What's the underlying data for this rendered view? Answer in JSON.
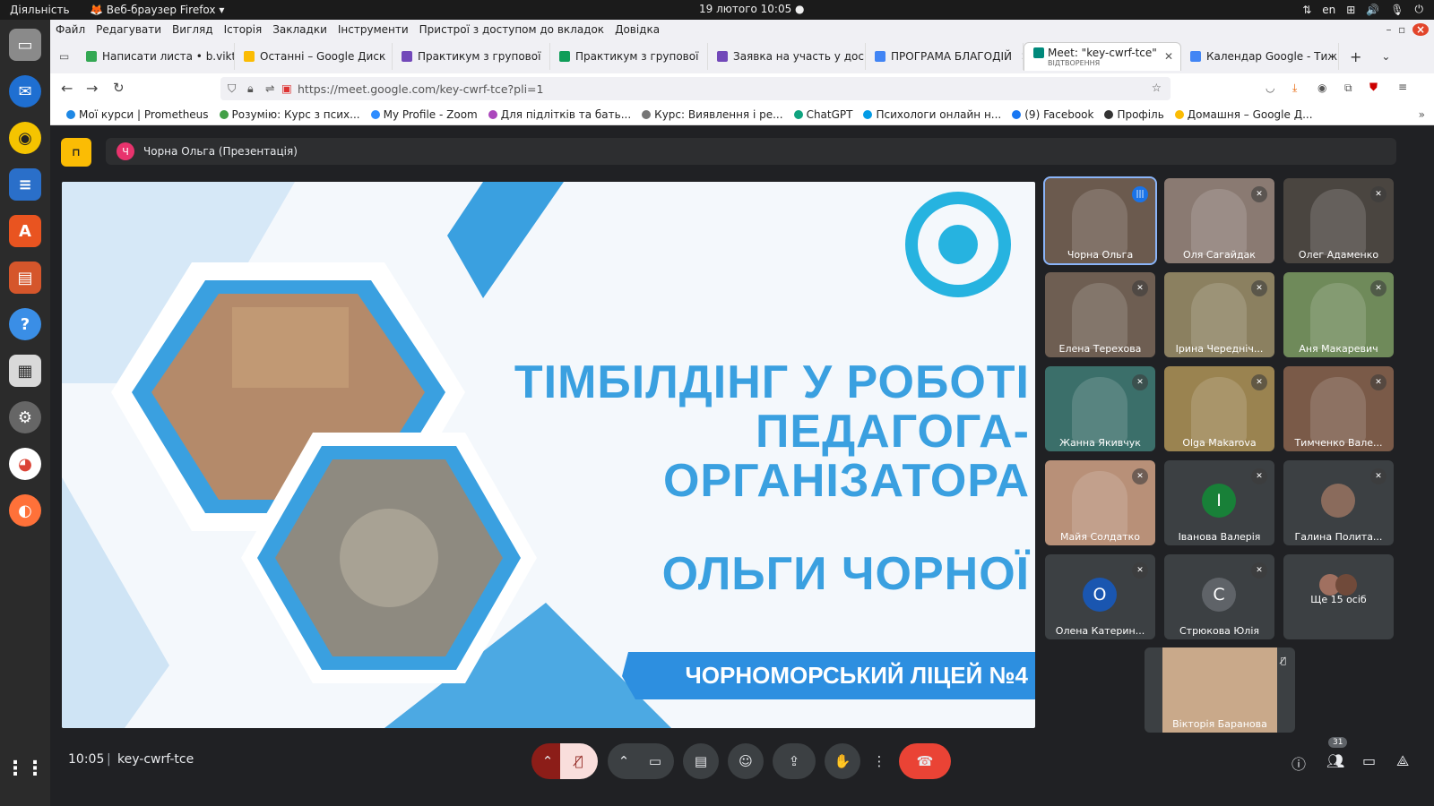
{
  "system": {
    "activities": "Діяльність",
    "app_menu": "Веб-браузер Firefox",
    "clock": "19 лютого  10:05",
    "lang": "en"
  },
  "menu": [
    "Файл",
    "Редагувати",
    "Вигляд",
    "Історія",
    "Закладки",
    "Інструменти",
    "Пристрої з доступом до вкладок",
    "Довідка"
  ],
  "tabs": [
    {
      "label": "Написати листа • b.vikt",
      "color": "#34a853"
    },
    {
      "label": "Останні – Google Диск",
      "color": "#fbbc04"
    },
    {
      "label": "Практикум з групової",
      "color": "#7248b9"
    },
    {
      "label": "Практикум з групової",
      "color": "#0f9d58"
    },
    {
      "label": "Заявка на участь у дос",
      "color": "#7248b9"
    },
    {
      "label": "ПРОГРАМА БЛАГОДІЙ",
      "color": "#4285f4"
    },
    {
      "label": "Meet: \"key-cwrf-tce\"",
      "sublabel": "ВІДТВОРЕННЯ",
      "color": "#00897b",
      "active": true
    },
    {
      "label": "Календар Google - Тиж",
      "color": "#4285f4"
    }
  ],
  "url": "https://meet.google.com/key-cwrf-tce?pli=1",
  "bookmarks": [
    {
      "label": "Мої курси | Prometheus",
      "color": "#1e88e5"
    },
    {
      "label": "Розумію: Курс з псих...",
      "color": "#43a047"
    },
    {
      "label": "My Profile - Zoom",
      "color": "#2d8cff"
    },
    {
      "label": "Для підлітків та бать...",
      "color": "#ab47bc"
    },
    {
      "label": "Курс: Виявлення і ре...",
      "color": "#757575"
    },
    {
      "label": "ChatGPT",
      "color": "#10a37f"
    },
    {
      "label": "Психологи онлайн н...",
      "color": "#039be5"
    },
    {
      "label": "(9) Facebook",
      "color": "#1877f2"
    },
    {
      "label": "Профіль",
      "color": "#333333"
    },
    {
      "label": "Домашня – Google Д...",
      "color": "#fbbc04"
    }
  ],
  "presentation": {
    "avatar_letter": "Ч",
    "label": "Чорна Ольга (Презентація)"
  },
  "slide": {
    "title_lines": [
      "ТІМБІЛДІНГ У РОБОТІ",
      "ПЕДАГОГА-",
      "ОРГАНІЗАТОРА",
      "ОЛЬГИ ЧОРНОЇ"
    ],
    "banner": "ЧОРНОМОРСЬКИЙ ЛІЦЕЙ №4"
  },
  "participants": [
    {
      "name": "Чорна Ольга",
      "speaking": true,
      "bg": "#6b5a4e"
    },
    {
      "name": "Оля Сагайдак",
      "bg": "#8a7a72"
    },
    {
      "name": "Олег Адаменко",
      "bg": "#4a4540"
    },
    {
      "name": "Елена Терехова",
      "bg": "#6e5e52"
    },
    {
      "name": "Ірина Чередніч...",
      "bg": "#8b8060"
    },
    {
      "name": "Аня Макаревич",
      "bg": "#6f8a5a"
    },
    {
      "name": "Жанна Якивчук",
      "bg": "#3b6f6a"
    },
    {
      "name": "Olga Makarova",
      "bg": "#9a8350"
    },
    {
      "name": "Тимченко Вале...",
      "bg": "#7a5a48"
    },
    {
      "name": "Майя Солдатко",
      "bg": "#b89078"
    },
    {
      "name": "Іванова Валерія",
      "letter": "І",
      "avatar_color": "#188038",
      "bg": "#3c4043"
    },
    {
      "name": "Галина Полита...",
      "bg": "#3c4043",
      "photo": true
    },
    {
      "name": "Олена Катерин...",
      "letter": "О",
      "avatar_color": "#1a56b0",
      "bg": "#3c4043"
    },
    {
      "name": "Стрюкова Юлія",
      "letter": "С",
      "avatar_color": "#5f6368",
      "bg": "#3c4043"
    },
    {
      "name": "Ще 15 осіб",
      "bg": "#3c4043",
      "more": true
    }
  ],
  "self_tile": {
    "name": "Вікторія Баранова"
  },
  "bottom": {
    "time": "10:05",
    "separator": "|",
    "meeting_code": "key-cwrf-tce",
    "people_count": "31"
  }
}
